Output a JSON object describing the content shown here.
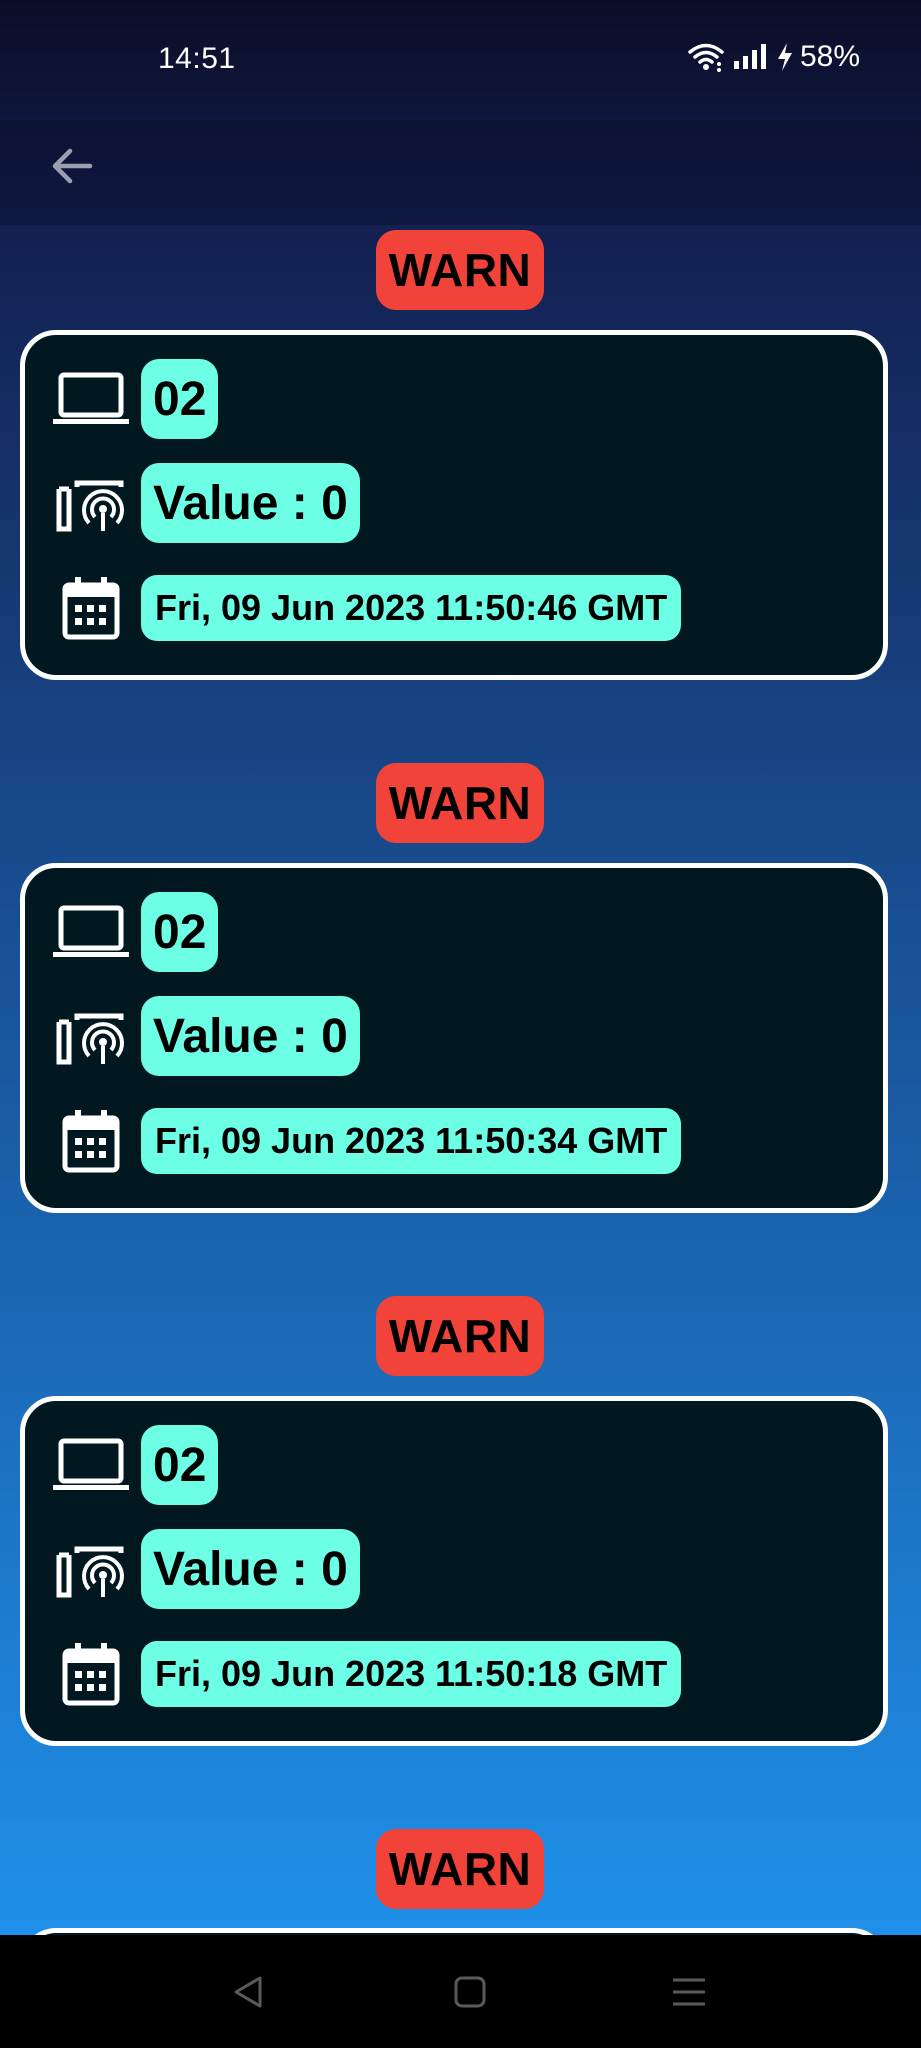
{
  "status_bar": {
    "time": "14:51",
    "battery": "58%"
  },
  "header": {
    "back_icon": "arrow-left-icon"
  },
  "entries": [
    {
      "level": "WARN",
      "device": "02",
      "value": "Value : 0",
      "date": "Fri, 09 Jun 2023 11:50:46 GMT"
    },
    {
      "level": "WARN",
      "device": "02",
      "value": "Value : 0",
      "date": "Fri, 09 Jun 2023 11:50:34 GMT"
    },
    {
      "level": "WARN",
      "device": "02",
      "value": "Value : 0",
      "date": "Fri, 09 Jun 2023 11:50:18 GMT"
    },
    {
      "level": "WARN"
    }
  ],
  "colors": {
    "warn_badge": "#f2433a",
    "pill": "#6cffe6",
    "card_bg": "#011820",
    "card_border": "#ffffff"
  },
  "icons": {
    "device": "laptop-icon",
    "value": "sensor-signal-icon",
    "date": "calendar-icon"
  },
  "nav": {
    "back": "nav-back-icon",
    "home": "nav-home-icon",
    "menu": "nav-menu-icon"
  }
}
